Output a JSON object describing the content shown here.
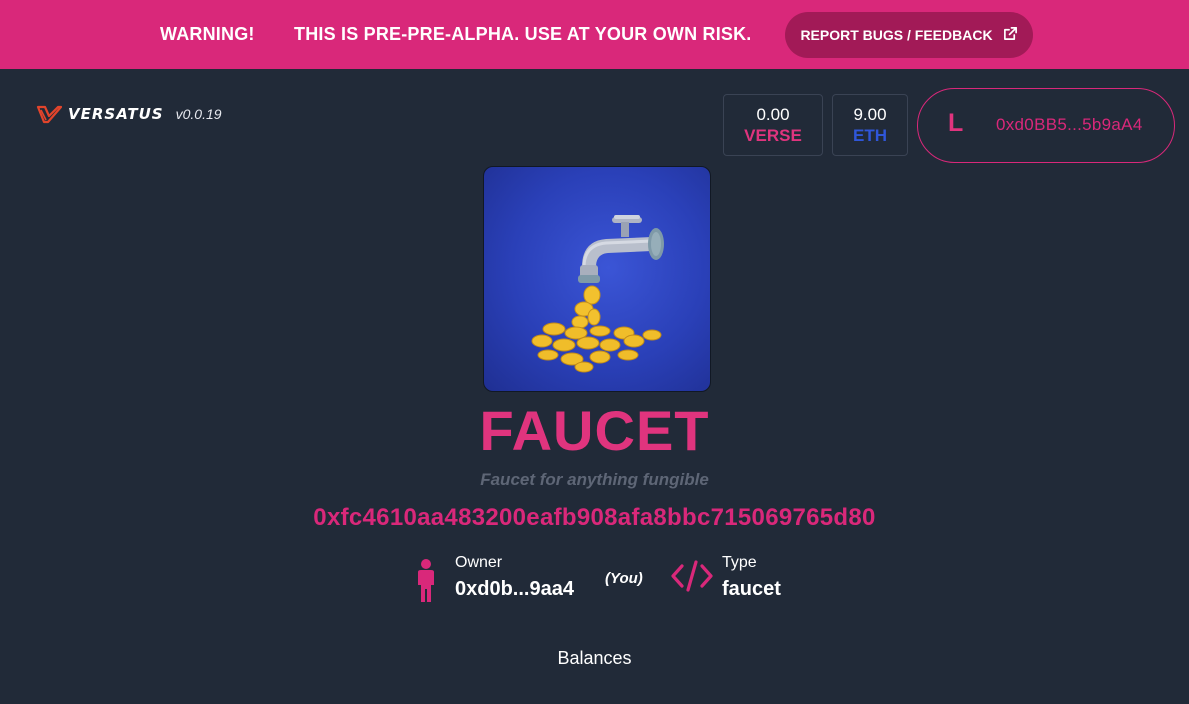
{
  "banner": {
    "warning": "WARNING!",
    "message": "THIS IS PRE-PRE-ALPHA. USE AT YOUR OWN RISK.",
    "report_button": "REPORT BUGS / FEEDBACK",
    "background": "#d9287a"
  },
  "header": {
    "logo_text": "VERSATUS",
    "version": "v0.0.19"
  },
  "balances_bar": {
    "verse": {
      "amount": "0.00",
      "currency": "VERSE",
      "color": "#e0347e"
    },
    "eth": {
      "amount": "9.00",
      "currency": "ETH",
      "color": "#2f56d9"
    }
  },
  "wallet": {
    "initial": "L",
    "address": "0xd0BB5...5b9aA4"
  },
  "program": {
    "image_icon": "faucet-coins-image",
    "name": "FAUCET",
    "description": "Faucet for anything fungible",
    "address": "0xfc4610aa483200eafb908afa8bbc715069765d80",
    "owner_label": "Owner",
    "owner_value": "0xd0b...9aa4",
    "owner_you": "(You)",
    "type_label": "Type",
    "type_value": "faucet",
    "balances_heading": "Balances"
  }
}
